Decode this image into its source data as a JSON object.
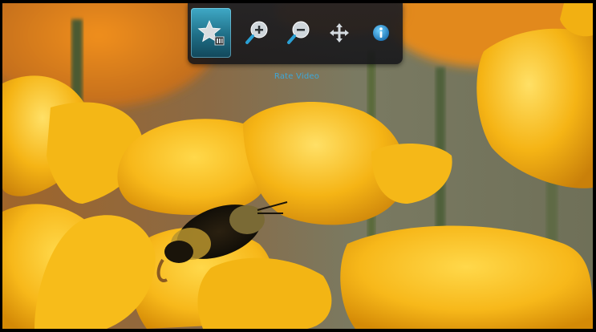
{
  "viewer": {
    "photo_subject": "bee-on-yellow-flower"
  },
  "toolbar": {
    "buttons": [
      {
        "id": "rate",
        "icon": "star-rating-icon",
        "active": true
      },
      {
        "id": "zoom-in",
        "icon": "zoom-in-icon",
        "active": false
      },
      {
        "id": "zoom-out",
        "icon": "zoom-out-icon",
        "active": false
      },
      {
        "id": "pan",
        "icon": "pan-arrows-icon",
        "active": false
      },
      {
        "id": "info",
        "icon": "info-icon",
        "active": false
      }
    ],
    "tooltip": "Rate Video",
    "accent_color": "#3ea7d8"
  }
}
